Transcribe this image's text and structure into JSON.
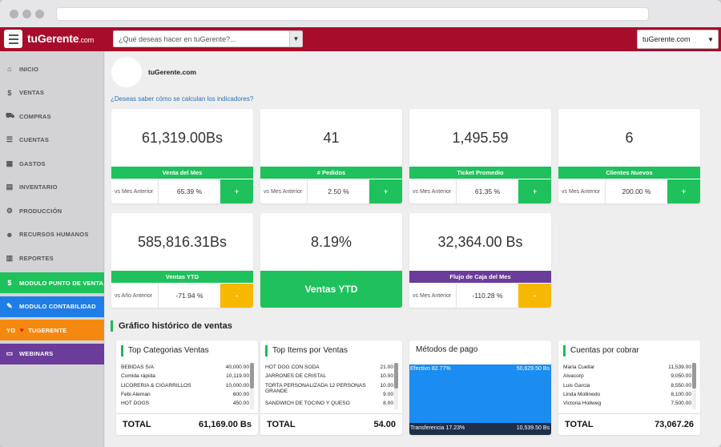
{
  "header": {
    "logo": "tuGerente",
    "logo_suffix": ".com",
    "search_placeholder": "¿Qué deseas hacer en tuGerente?...",
    "company_select": "tuGerente.com"
  },
  "sidebar": {
    "items": [
      {
        "label": "INICIO",
        "icon": "home-icon",
        "glyph": "⌂"
      },
      {
        "label": "VENTAS",
        "icon": "dollar-icon",
        "glyph": "$"
      },
      {
        "label": "COMPRAS",
        "icon": "cart-icon",
        "glyph": "⛟"
      },
      {
        "label": "CUENTAS",
        "icon": "list-icon",
        "glyph": "☰"
      },
      {
        "label": "GASTOS",
        "icon": "calculator-icon",
        "glyph": "▦"
      },
      {
        "label": "INVENTARIO",
        "icon": "inventory-icon",
        "glyph": "▤"
      },
      {
        "label": "PRODUCCIÓN",
        "icon": "gear-icon",
        "glyph": "⚙"
      },
      {
        "label": "RECURSOS HUMANOS",
        "icon": "people-icon",
        "glyph": "☻"
      },
      {
        "label": "REPORTES",
        "icon": "chart-icon",
        "glyph": "▥"
      }
    ],
    "highlights": [
      {
        "label": "MODULO PUNTO DE VENTA",
        "color": "#1ec15b",
        "glyph": "$",
        "icon": "dollar-icon"
      },
      {
        "label": "MODULO CONTABILIDAD",
        "color": "#1e7ee6",
        "glyph": "✎",
        "icon": "pencil-icon"
      },
      {
        "label": "TUGERENTE",
        "prefix": "YO",
        "color": "#f5890f",
        "glyph": "♥",
        "icon": "heart-icon"
      },
      {
        "label": "WEBINARS",
        "color": "#6b3c9a",
        "glyph": "▭",
        "icon": "laptop-icon"
      }
    ]
  },
  "main": {
    "company_name": "tuGerente.com",
    "help_link": "¿Deseas saber cómo se calculan los indicadores?",
    "kpis": [
      {
        "value": "61,319.00Bs",
        "label": "Venta del Mes",
        "cmp_label": "vs Mes Anterior",
        "pct": "65.39 %",
        "btn": "+",
        "bar_color": "#1ec15b",
        "btn_color": "#1ec15b"
      },
      {
        "value": "41",
        "label": "# Pedidos",
        "cmp_label": "vs Mes Anterior",
        "pct": "2.50 %",
        "btn": "+",
        "bar_color": "#1ec15b",
        "btn_color": "#1ec15b"
      },
      {
        "value": "1,495.59",
        "label": "Ticket Promedio",
        "cmp_label": "vs Mes Anterior",
        "pct": "61.35 %",
        "btn": "+",
        "bar_color": "#1ec15b",
        "btn_color": "#1ec15b"
      },
      {
        "value": "6",
        "label": "Clientes Nuevos",
        "cmp_label": "vs Mes Anterior",
        "pct": "200.00 %",
        "btn": "+",
        "bar_color": "#1ec15b",
        "btn_color": "#1ec15b"
      },
      {
        "value": "585,816.31Bs",
        "label": "Ventas YTD",
        "cmp_label": "vs Año Anterior",
        "pct": "-71.94 %",
        "btn": "-",
        "bar_color": "#1ec15b",
        "btn_color": "#f6b800"
      },
      {
        "value": "8.19%",
        "label": "Ventas YTD",
        "bar_color": "#1ec15b"
      },
      {
        "value": "32,364.00 Bs",
        "label": "Flujo de Caja del Mes",
        "cmp_label": "vs Mes Anterior",
        "pct": "-110.28 %",
        "btn": "-",
        "bar_color": "#6b3c9a",
        "btn_color": "#f6b800"
      }
    ],
    "section_title": "Gráfico histórico de ventas",
    "top_categories": {
      "title": "Top Categorias Ventas",
      "rows": [
        [
          "BEBIDAS S/A",
          "40,000.00"
        ],
        [
          "Comida rápida",
          "10,119.00"
        ],
        [
          "LICORERIA & CIGARRILLOS",
          "10,000.00"
        ],
        [
          "Febi Aleman",
          "600.00"
        ],
        [
          "HOT DOGS",
          "450.00"
        ]
      ],
      "total_label": "TOTAL",
      "total_value": "61,169.00 Bs"
    },
    "top_items": {
      "title": "Top Items por Ventas",
      "rows": [
        [
          "HOT DOG CON SODA",
          "21.00"
        ],
        [
          "JARRONES DE CRISTAL",
          "10.00"
        ],
        [
          "TORTA PERSONALIZADA 12 PERSONAS GRANDE",
          "10.00"
        ],
        [
          "",
          "9.00"
        ],
        [
          "SANDWICH DE TOCINO Y QUESO",
          "8.00"
        ]
      ],
      "total_label": "TOTAL",
      "total_value": "54.00"
    },
    "payment_methods": {
      "title": "Métodos de pago",
      "items": [
        {
          "label": "Efectivo",
          "pct": "82.77%",
          "value": "50,629.50 Bs",
          "share": 0.8277,
          "color": "#1a8cf2"
        },
        {
          "label": "Transferencia",
          "pct": "17.23%",
          "value": "10,539.50 Bs",
          "share": 0.1723,
          "color": "#1d2f49"
        }
      ]
    },
    "receivables": {
      "title": "Cuentas por cobrar",
      "rows": [
        [
          "Maria Cuellar",
          "11,539.00"
        ],
        [
          "Alvacorp",
          "9,050.00"
        ],
        [
          "Luis Garcia",
          "8,550.00"
        ],
        [
          "Linda Mollinedo",
          "8,100.00"
        ],
        [
          "Victoria Hollweg",
          "7,500.00"
        ]
      ],
      "total_label": "TOTAL",
      "total_value": "73,067.26"
    }
  }
}
